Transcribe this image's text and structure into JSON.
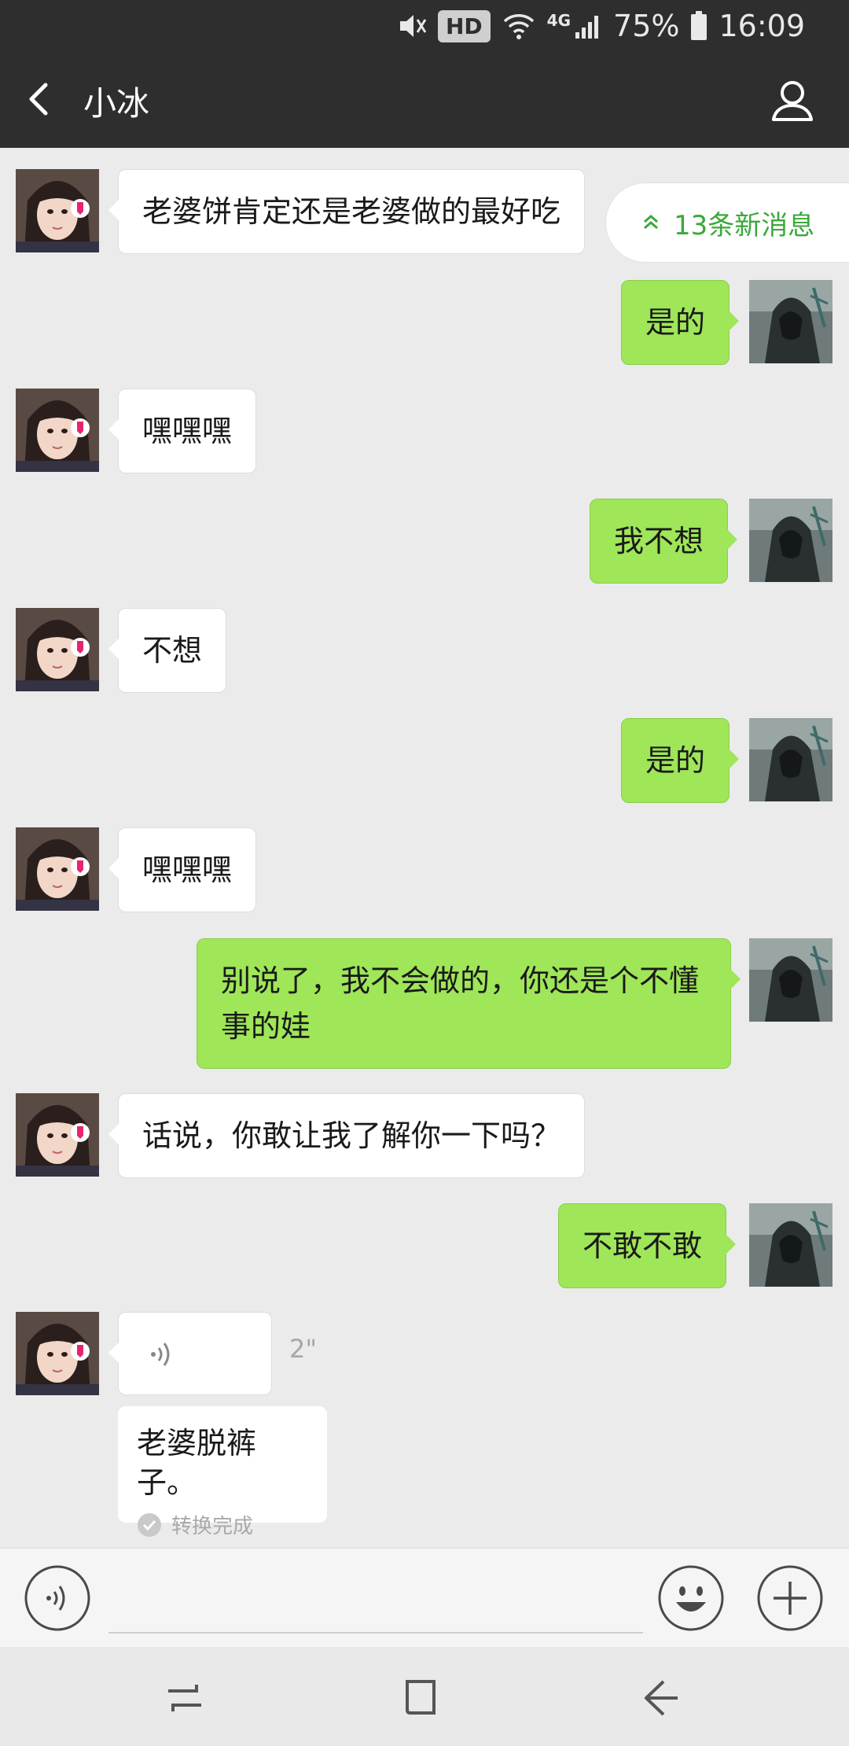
{
  "status_bar": {
    "hd": "HD",
    "network": "4G",
    "battery": "75%",
    "time": "16:09"
  },
  "header": {
    "title": "小冰"
  },
  "new_messages_pill": "13条新消息",
  "messages": [
    {
      "side": "left",
      "text": "老婆饼肯定还是老婆做的最好吃"
    },
    {
      "side": "right",
      "text": "是的"
    },
    {
      "side": "left",
      "text": "嘿嘿嘿"
    },
    {
      "side": "right",
      "text": "我不想"
    },
    {
      "side": "left",
      "text": "不想"
    },
    {
      "side": "right",
      "text": "是的"
    },
    {
      "side": "left",
      "text": "嘿嘿嘿"
    },
    {
      "side": "right",
      "text": "别说了，我不会做的，你还是个不懂事的娃"
    },
    {
      "side": "left",
      "text": "话说，你敢让我了解你一下吗？"
    },
    {
      "side": "right",
      "text": "不敢不敢"
    }
  ],
  "voice_message": {
    "duration": "2\"",
    "transcript": "老婆脱裤子。",
    "transcript_status": "转换完成"
  },
  "input": {
    "value": "",
    "placeholder": ""
  },
  "colors": {
    "header_bg": "#2e2e2e",
    "chat_bg": "#ebebeb",
    "outgoing_bubble": "#9fe658",
    "incoming_bubble": "#ffffff",
    "accent_green": "#3aa83a"
  },
  "icons": {
    "back": "back-arrow-icon",
    "profile": "person-icon",
    "voice": "voice-icon",
    "emoji": "emoji-smile-icon",
    "plus": "plus-icon"
  }
}
